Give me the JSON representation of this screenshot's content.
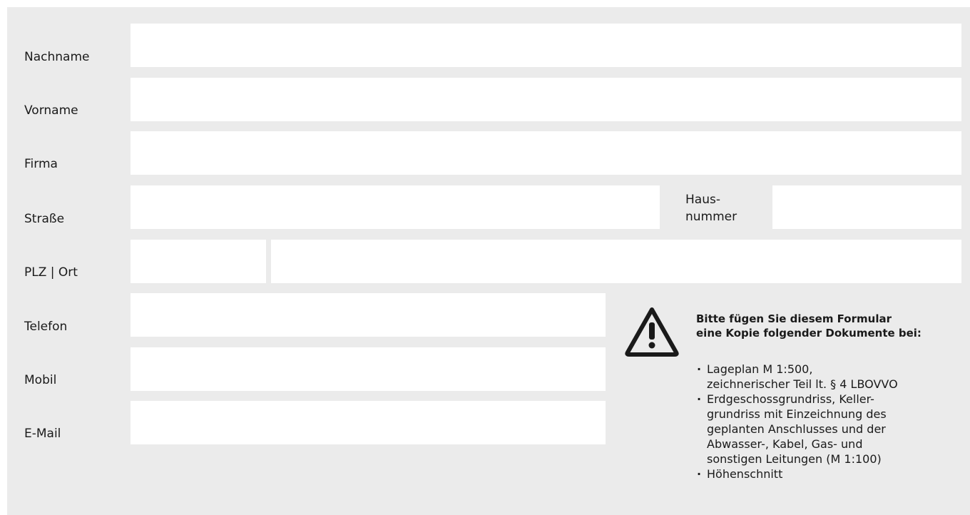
{
  "form": {
    "labels": {
      "nachname": "Nachname",
      "vorname": "Vorname",
      "firma": "Firma",
      "strasse": "Straße",
      "hausnummer": "Haus-\nnummer",
      "plz_ort": "PLZ | Ort",
      "telefon": "Telefon",
      "mobil": "Mobil",
      "email": "E-Mail"
    },
    "values": {
      "nachname": "",
      "vorname": "",
      "firma": "",
      "strasse": "",
      "hausnummer": "",
      "plz": "",
      "ort": "",
      "telefon": "",
      "mobil": "",
      "email": ""
    }
  },
  "notice": {
    "icon": "warning-triangle-icon",
    "title": "Bitte fügen Sie diesem Formular\neine Kopie folgender Dokumente bei:",
    "items": [
      "Lageplan M 1:500,\nzeichnerischer Teil lt. § 4 LBOVVO",
      "Erdgeschossgrundriss, Keller-\ngrundriss mit Einzeichnung des\ngeplanten Anschlusses und der\nAbwasser-, Kabel, Gas- und\nsonstigen Leitungen (M 1:100)",
      "Höhenschnitt"
    ]
  },
  "colors": {
    "panel_background": "#ebebeb",
    "field_background": "#ffffff",
    "text": "#1a1a1a"
  }
}
